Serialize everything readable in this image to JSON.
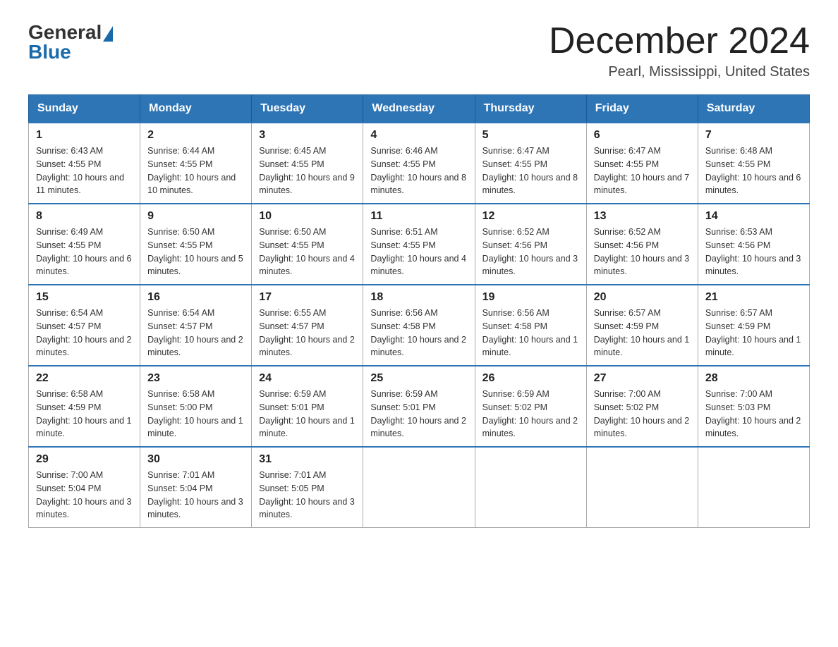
{
  "logo": {
    "general": "General",
    "blue": "Blue"
  },
  "title": "December 2024",
  "subtitle": "Pearl, Mississippi, United States",
  "days_of_week": [
    "Sunday",
    "Monday",
    "Tuesday",
    "Wednesday",
    "Thursday",
    "Friday",
    "Saturday"
  ],
  "weeks": [
    [
      {
        "day": "1",
        "sunrise": "6:43 AM",
        "sunset": "4:55 PM",
        "daylight": "10 hours and 11 minutes."
      },
      {
        "day": "2",
        "sunrise": "6:44 AM",
        "sunset": "4:55 PM",
        "daylight": "10 hours and 10 minutes."
      },
      {
        "day": "3",
        "sunrise": "6:45 AM",
        "sunset": "4:55 PM",
        "daylight": "10 hours and 9 minutes."
      },
      {
        "day": "4",
        "sunrise": "6:46 AM",
        "sunset": "4:55 PM",
        "daylight": "10 hours and 8 minutes."
      },
      {
        "day": "5",
        "sunrise": "6:47 AM",
        "sunset": "4:55 PM",
        "daylight": "10 hours and 8 minutes."
      },
      {
        "day": "6",
        "sunrise": "6:47 AM",
        "sunset": "4:55 PM",
        "daylight": "10 hours and 7 minutes."
      },
      {
        "day": "7",
        "sunrise": "6:48 AM",
        "sunset": "4:55 PM",
        "daylight": "10 hours and 6 minutes."
      }
    ],
    [
      {
        "day": "8",
        "sunrise": "6:49 AM",
        "sunset": "4:55 PM",
        "daylight": "10 hours and 6 minutes."
      },
      {
        "day": "9",
        "sunrise": "6:50 AM",
        "sunset": "4:55 PM",
        "daylight": "10 hours and 5 minutes."
      },
      {
        "day": "10",
        "sunrise": "6:50 AM",
        "sunset": "4:55 PM",
        "daylight": "10 hours and 4 minutes."
      },
      {
        "day": "11",
        "sunrise": "6:51 AM",
        "sunset": "4:55 PM",
        "daylight": "10 hours and 4 minutes."
      },
      {
        "day": "12",
        "sunrise": "6:52 AM",
        "sunset": "4:56 PM",
        "daylight": "10 hours and 3 minutes."
      },
      {
        "day": "13",
        "sunrise": "6:52 AM",
        "sunset": "4:56 PM",
        "daylight": "10 hours and 3 minutes."
      },
      {
        "day": "14",
        "sunrise": "6:53 AM",
        "sunset": "4:56 PM",
        "daylight": "10 hours and 3 minutes."
      }
    ],
    [
      {
        "day": "15",
        "sunrise": "6:54 AM",
        "sunset": "4:57 PM",
        "daylight": "10 hours and 2 minutes."
      },
      {
        "day": "16",
        "sunrise": "6:54 AM",
        "sunset": "4:57 PM",
        "daylight": "10 hours and 2 minutes."
      },
      {
        "day": "17",
        "sunrise": "6:55 AM",
        "sunset": "4:57 PM",
        "daylight": "10 hours and 2 minutes."
      },
      {
        "day": "18",
        "sunrise": "6:56 AM",
        "sunset": "4:58 PM",
        "daylight": "10 hours and 2 minutes."
      },
      {
        "day": "19",
        "sunrise": "6:56 AM",
        "sunset": "4:58 PM",
        "daylight": "10 hours and 1 minute."
      },
      {
        "day": "20",
        "sunrise": "6:57 AM",
        "sunset": "4:59 PM",
        "daylight": "10 hours and 1 minute."
      },
      {
        "day": "21",
        "sunrise": "6:57 AM",
        "sunset": "4:59 PM",
        "daylight": "10 hours and 1 minute."
      }
    ],
    [
      {
        "day": "22",
        "sunrise": "6:58 AM",
        "sunset": "4:59 PM",
        "daylight": "10 hours and 1 minute."
      },
      {
        "day": "23",
        "sunrise": "6:58 AM",
        "sunset": "5:00 PM",
        "daylight": "10 hours and 1 minute."
      },
      {
        "day": "24",
        "sunrise": "6:59 AM",
        "sunset": "5:01 PM",
        "daylight": "10 hours and 1 minute."
      },
      {
        "day": "25",
        "sunrise": "6:59 AM",
        "sunset": "5:01 PM",
        "daylight": "10 hours and 2 minutes."
      },
      {
        "day": "26",
        "sunrise": "6:59 AM",
        "sunset": "5:02 PM",
        "daylight": "10 hours and 2 minutes."
      },
      {
        "day": "27",
        "sunrise": "7:00 AM",
        "sunset": "5:02 PM",
        "daylight": "10 hours and 2 minutes."
      },
      {
        "day": "28",
        "sunrise": "7:00 AM",
        "sunset": "5:03 PM",
        "daylight": "10 hours and 2 minutes."
      }
    ],
    [
      {
        "day": "29",
        "sunrise": "7:00 AM",
        "sunset": "5:04 PM",
        "daylight": "10 hours and 3 minutes."
      },
      {
        "day": "30",
        "sunrise": "7:01 AM",
        "sunset": "5:04 PM",
        "daylight": "10 hours and 3 minutes."
      },
      {
        "day": "31",
        "sunrise": "7:01 AM",
        "sunset": "5:05 PM",
        "daylight": "10 hours and 3 minutes."
      },
      null,
      null,
      null,
      null
    ]
  ]
}
